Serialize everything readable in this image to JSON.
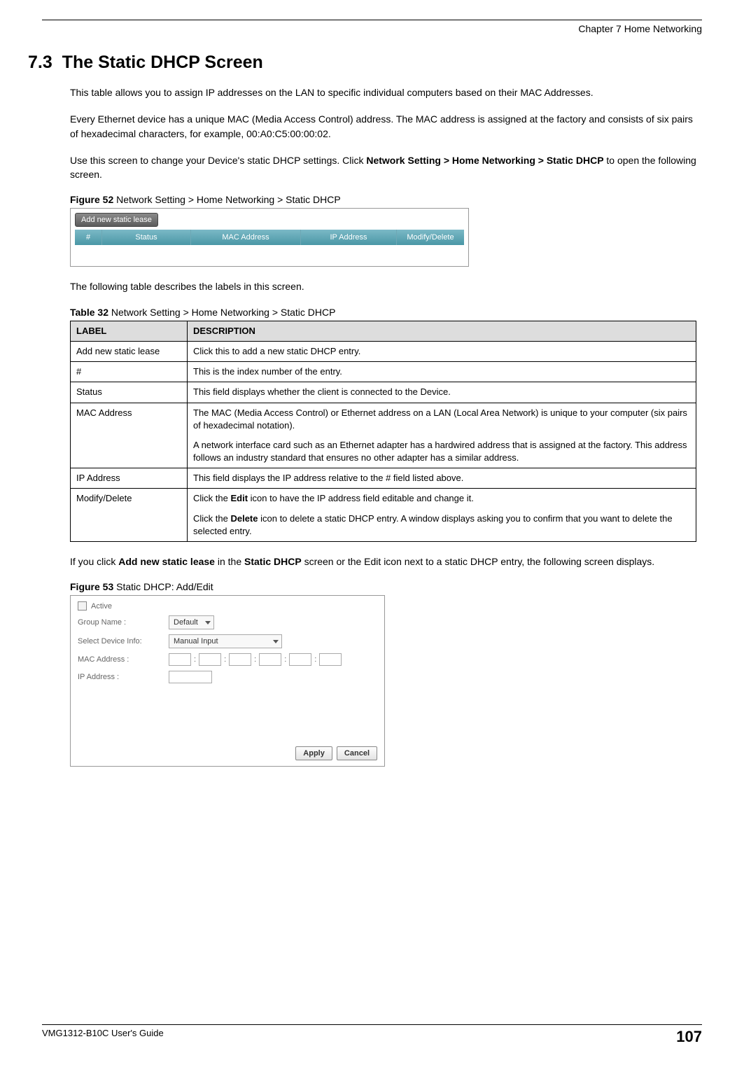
{
  "header": {
    "chapter": "Chapter 7 Home Networking"
  },
  "section": {
    "number": "7.3",
    "title": "The Static DHCP Screen"
  },
  "paras": {
    "p1": "This table allows you to assign IP addresses on the LAN to specific individual computers based on their MAC Addresses.",
    "p2": "Every Ethernet device has a unique MAC (Media Access Control) address. The MAC address is assigned at the factory and consists of six pairs of hexadecimal characters, for example, 00:A0:C5:00:00:02.",
    "p3a": "Use this screen to change your Device's static DHCP settings. Click ",
    "p3b": "Network Setting > Home Networking > Static DHCP",
    "p3c": " to open the following screen.",
    "p4": "The following table describes the labels in this screen.",
    "p5a": "If you click ",
    "p5b": "Add new static lease",
    "p5c": " in the ",
    "p5d": "Static DHCP",
    "p5e": " screen or the Edit icon next to a static DHCP entry, the following screen displays."
  },
  "figure52": {
    "label_bold": "Figure 52",
    "label_rest": "   Network Setting > Home Networking > Static DHCP",
    "button": "Add new static lease",
    "cols": {
      "num": "#",
      "status": "Status",
      "mac": "MAC Address",
      "ip": "IP Address",
      "mod": "Modify/Delete"
    }
  },
  "table32": {
    "label_bold": "Table 32",
    "label_rest": "   Network Setting > Home Networking > Static DHCP",
    "head_label": "LABEL",
    "head_desc": "DESCRIPTION",
    "rows": [
      {
        "label": "Add new static lease",
        "desc": "Click this to add a new static DHCP entry."
      },
      {
        "label": "#",
        "desc": "This is the index number of the entry."
      },
      {
        "label": "Status",
        "desc": "This field displays whether the client is connected to the Device."
      },
      {
        "label": "MAC Address",
        "desc1": "The MAC (Media Access Control) or Ethernet address on a LAN (Local Area Network) is unique to your computer (six pairs of hexadecimal notation).",
        "desc2": "A network interface card such as an Ethernet adapter has a hardwired address that is assigned at the factory. This address follows an industry standard that ensures no other adapter has a similar address."
      },
      {
        "label": "IP Address",
        "desc": "This field displays the IP address relative to the # field listed above."
      },
      {
        "label": "Modify/Delete",
        "desc1a": "Click the ",
        "desc1b": "Edit",
        "desc1c": " icon to have the IP address field editable and change it.",
        "desc2a": "Click the ",
        "desc2b": "Delete",
        "desc2c": " icon to delete a static DHCP entry. A window displays asking you to confirm that you want to delete the selected entry."
      }
    ]
  },
  "figure53": {
    "label_bold": "Figure 53",
    "label_rest": "   Static DHCP: Add/Edit",
    "active": "Active",
    "group_label": "Group Name :",
    "group_value": "Default",
    "select_device_label": "Select Device Info:",
    "select_device_value": "Manual Input",
    "mac_label": "MAC Address :",
    "ip_label": "IP Address :",
    "apply": "Apply",
    "cancel": "Cancel"
  },
  "footer": {
    "guide": "VMG1312-B10C User's Guide",
    "page": "107"
  }
}
